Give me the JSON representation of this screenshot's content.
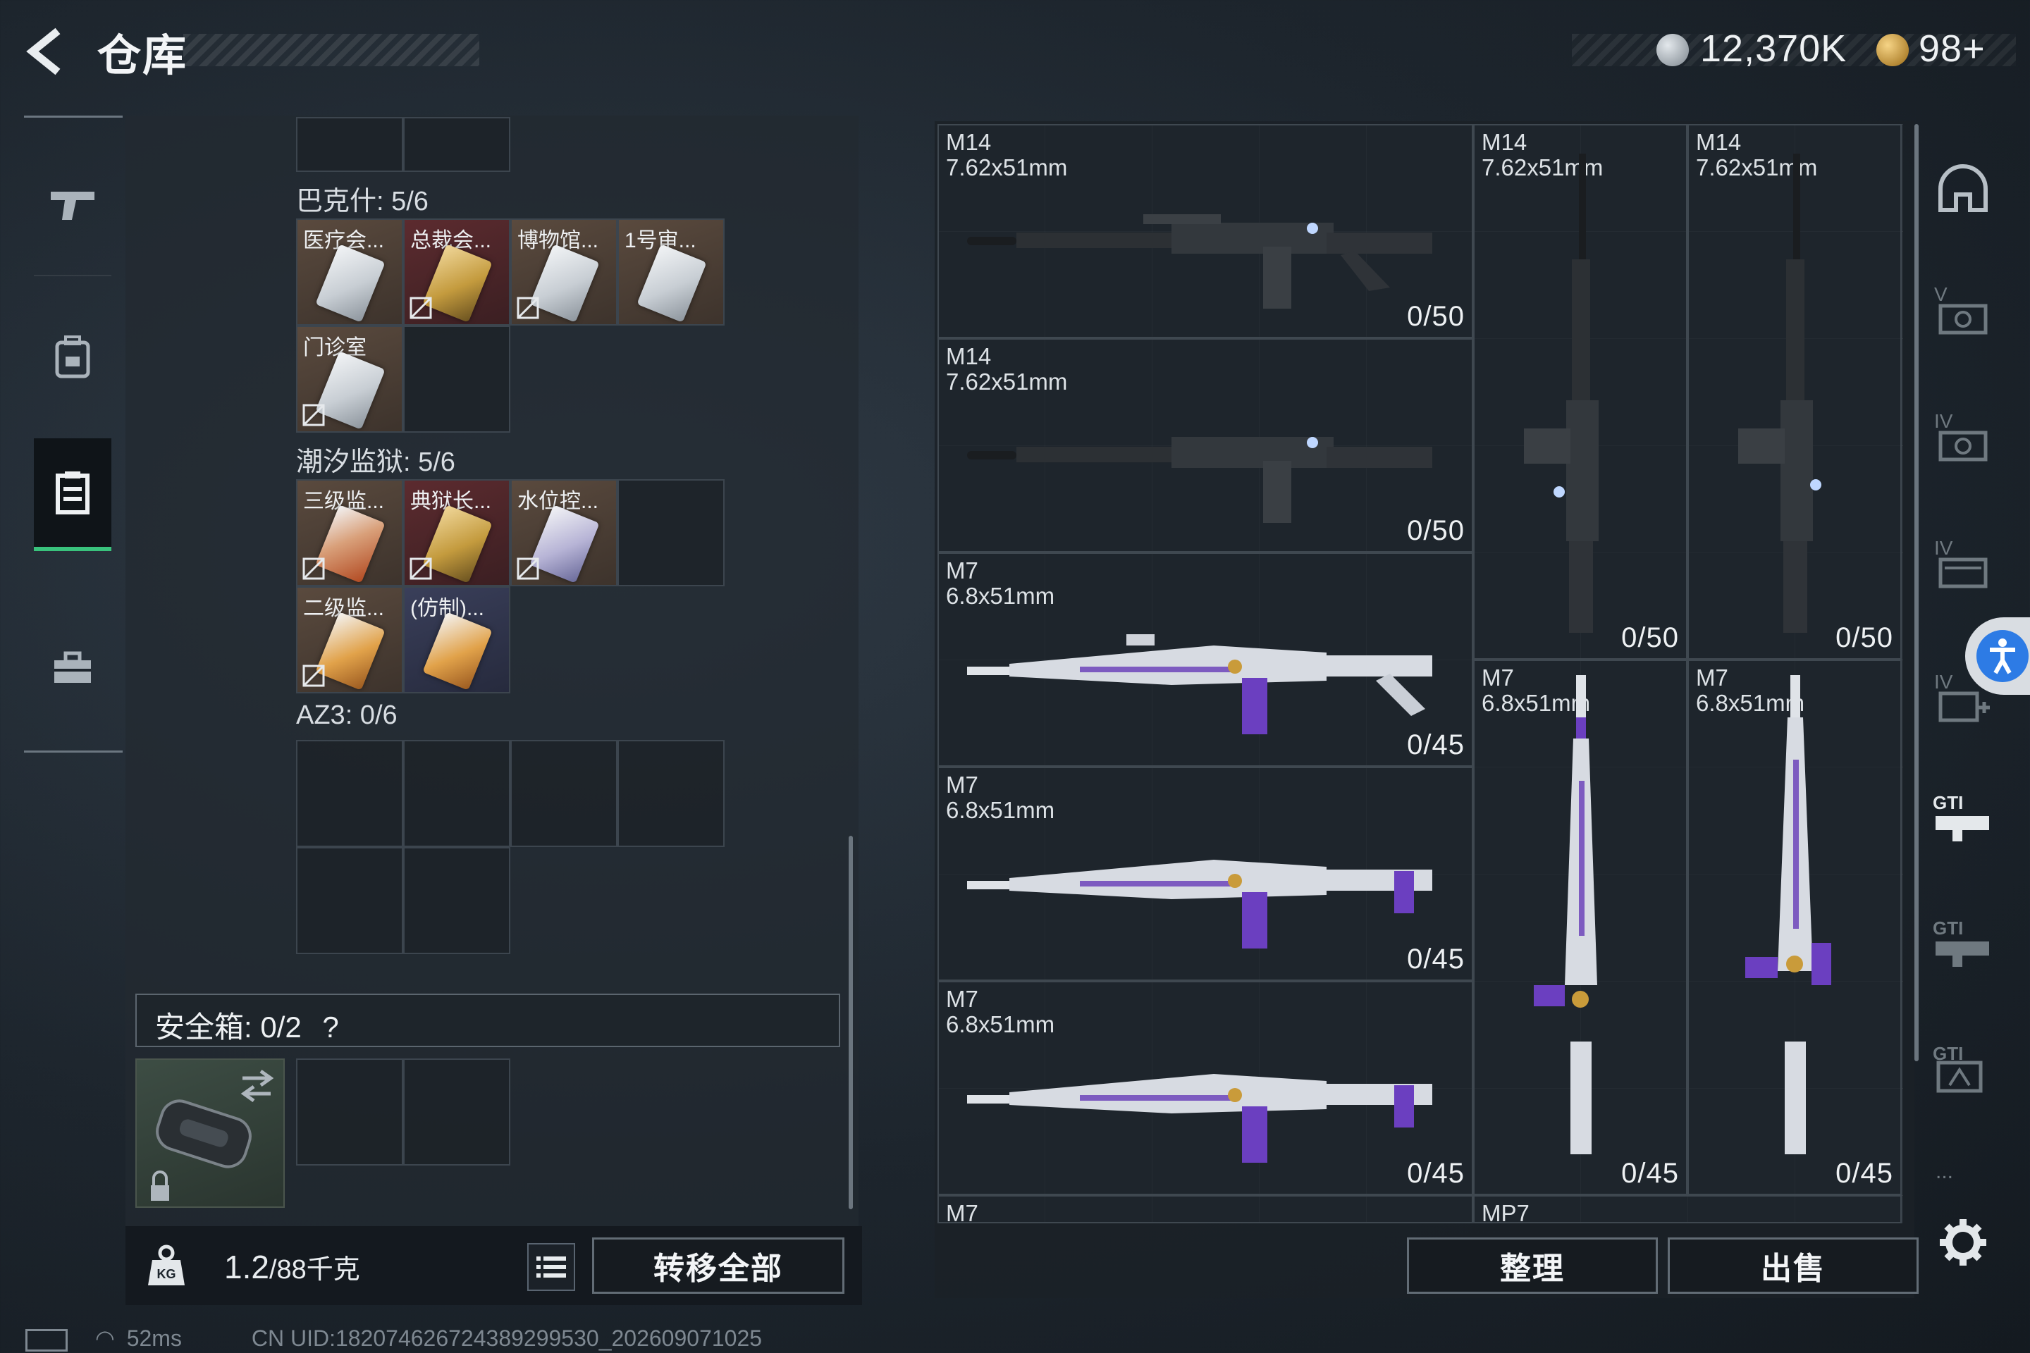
{
  "header": {
    "title": "仓库",
    "currency_main": "12,370K",
    "currency_secondary": "98+",
    "colors": {
      "accent_green": "#39c27c",
      "coin_silver": "#aeb6be",
      "coin_gold": "#d8a23a"
    }
  },
  "left_rail": {
    "items": [
      {
        "name": "pistol-icon",
        "active": false
      },
      {
        "name": "backpack-icon",
        "active": false
      },
      {
        "name": "clipboard-icon",
        "active": true
      },
      {
        "name": "toolbox-icon",
        "active": false
      }
    ]
  },
  "storage": {
    "sections": [
      {
        "label": "巴克什: 5/6"
      },
      {
        "label": "潮汐监狱: 5/6"
      },
      {
        "label": "AZ3: 0/6"
      }
    ],
    "bakeshi_keys": [
      "医疗会...",
      "总裁会...",
      "博物馆...",
      "1号审...",
      "门诊室"
    ],
    "chaoxi_keys": [
      "三级监...",
      "典狱长...",
      "水位控...",
      "二级监...",
      "(仿制)..."
    ],
    "safe_box_label": "安全箱: 0/2",
    "safe_box_help": "?",
    "weight_value": "1.2",
    "weight_max": "/88千克",
    "weight_icon_label": "KG",
    "transfer_all": "转移全部"
  },
  "weapons": [
    {
      "name": "M14",
      "caliber": "7.62x51mm",
      "ammo": "0/50"
    },
    {
      "name": "M14",
      "caliber": "7.62x51mm",
      "ammo": "0/50"
    },
    {
      "name": "M14",
      "caliber": "7.62x51mm",
      "ammo": "0/50"
    },
    {
      "name": "M14",
      "caliber": "7.62x51mm",
      "ammo": "0/50"
    },
    {
      "name": "M7",
      "caliber": "6.8x51mm",
      "ammo": "0/45"
    },
    {
      "name": "M7",
      "caliber": "6.8x51mm",
      "ammo": "0/45"
    },
    {
      "name": "M7",
      "caliber": "6.8x51mm",
      "ammo": "0/45"
    },
    {
      "name": "M7",
      "caliber": "6.8x51mm",
      "ammo": "0/45"
    },
    {
      "name": "M7",
      "caliber": "6.8x51mm",
      "ammo": "0/45"
    }
  ],
  "partial_row": {
    "left": "M7",
    "right": "MP7"
  },
  "actions": {
    "sort": "整理",
    "sell": "出售"
  },
  "side_icons": {
    "helmet_badge": "",
    "tier_labels": [
      "V",
      "IV",
      "IV",
      "IV",
      "GTI",
      "GTI",
      "GTI"
    ],
    "more": "..."
  },
  "status": {
    "latency": "52ms",
    "uid": "CN UID:182074626724389299530_202609071025"
  }
}
